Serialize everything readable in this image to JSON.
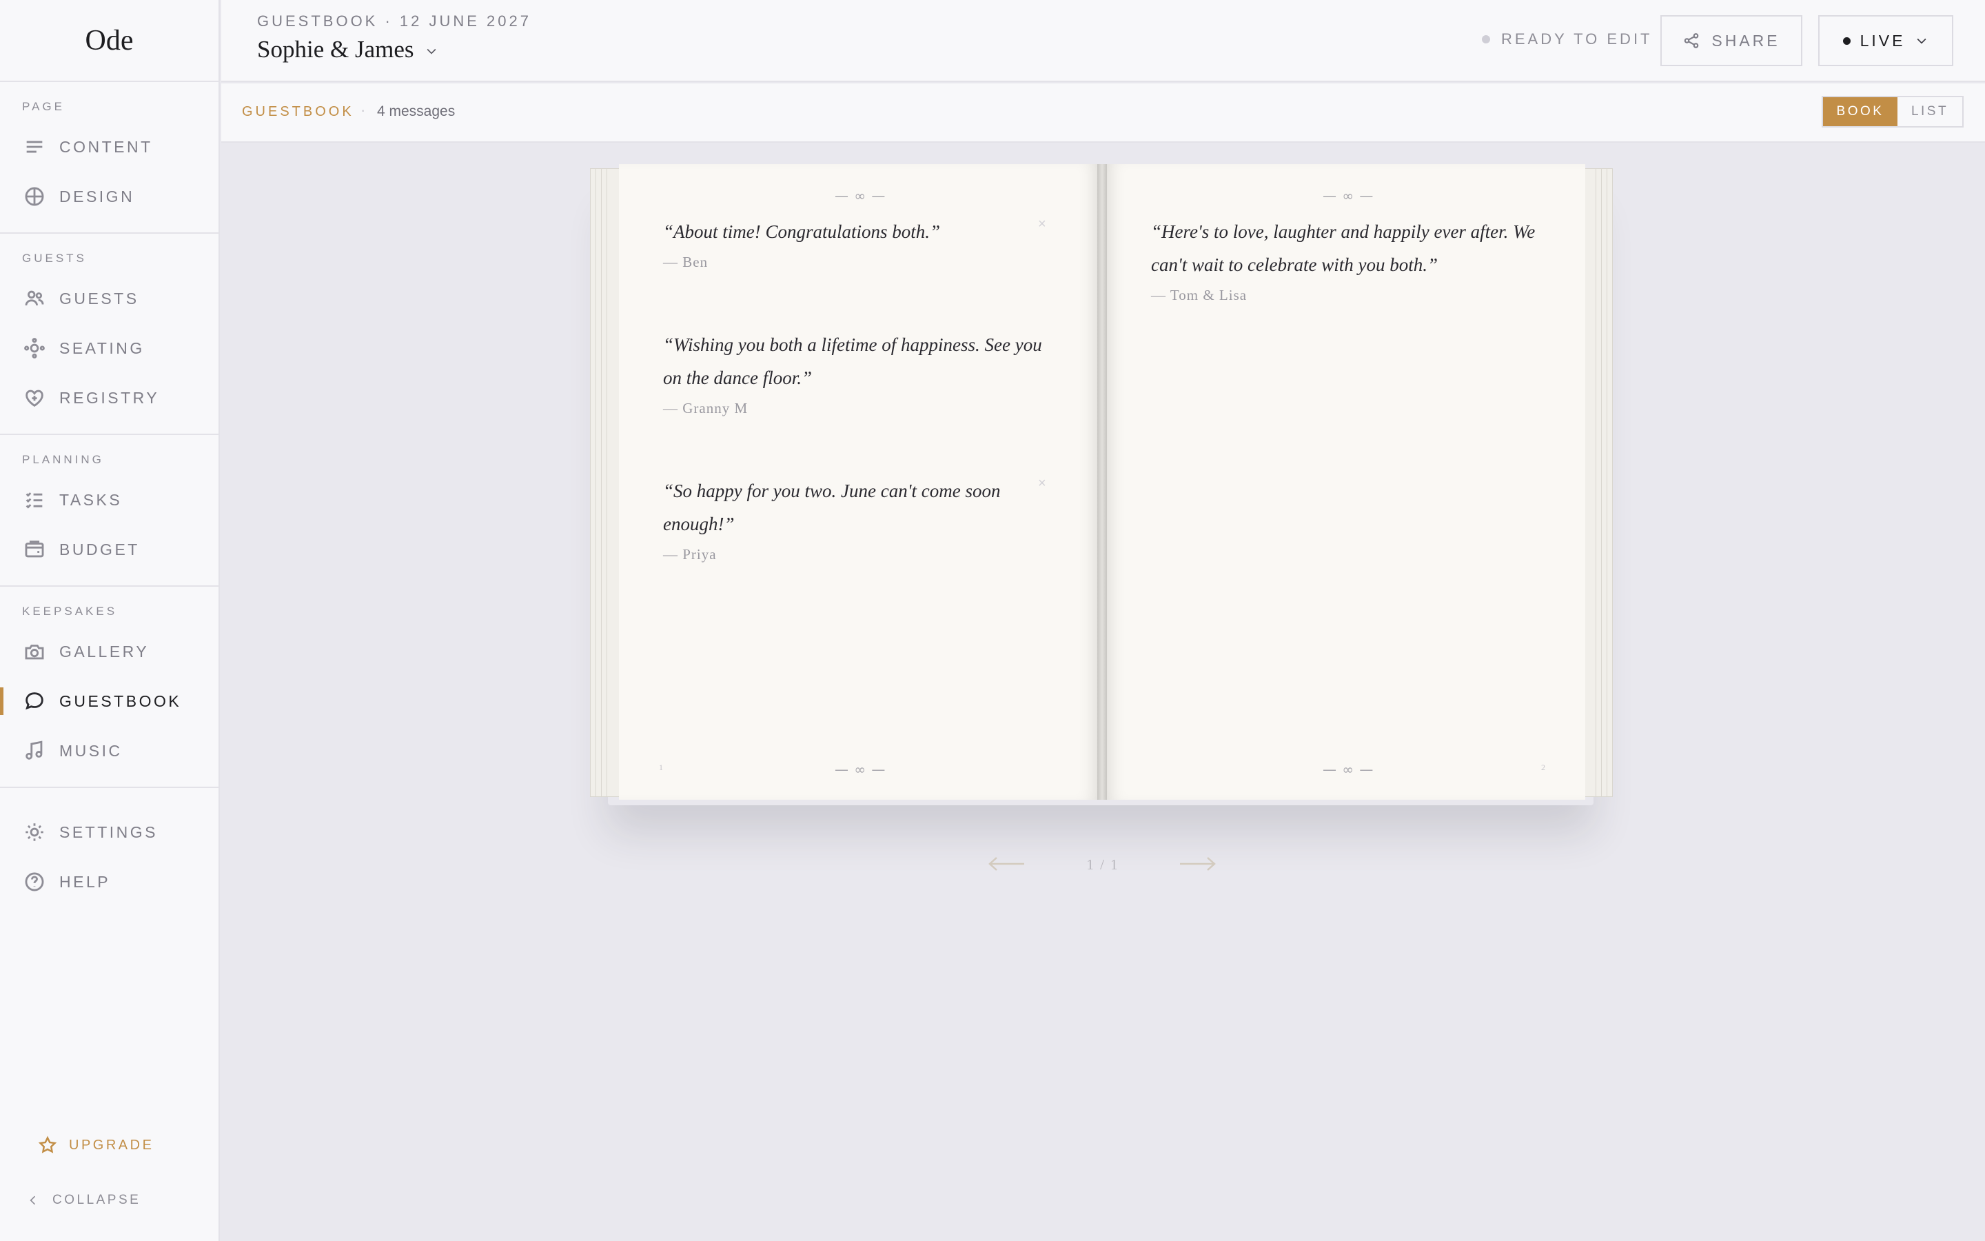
{
  "app": {
    "logo": "Ode"
  },
  "sidebar": {
    "sections": [
      {
        "label": "PAGE",
        "items": [
          {
            "label": "CONTENT",
            "icon": "content-lines-icon"
          },
          {
            "label": "DESIGN",
            "icon": "design-globe-icon"
          }
        ]
      },
      {
        "label": "GUESTS",
        "items": [
          {
            "label": "GUESTS",
            "icon": "users-icon"
          },
          {
            "label": "SEATING",
            "icon": "seating-nodes-icon"
          },
          {
            "label": "REGISTRY",
            "icon": "heart-plus-icon"
          }
        ]
      },
      {
        "label": "PLANNING",
        "items": [
          {
            "label": "TASKS",
            "icon": "checklist-icon"
          },
          {
            "label": "BUDGET",
            "icon": "wallet-icon"
          }
        ]
      },
      {
        "label": "KEEPSAKES",
        "items": [
          {
            "label": "GALLERY",
            "icon": "camera-icon"
          },
          {
            "label": "GUESTBOOK",
            "icon": "speech-bubble-icon",
            "active": true
          },
          {
            "label": "MUSIC",
            "icon": "music-note-icon"
          }
        ]
      },
      {
        "label": "",
        "items": [
          {
            "label": "SETTINGS",
            "icon": "sun-gear-icon"
          },
          {
            "label": "HELP",
            "icon": "help-circle-icon"
          }
        ]
      }
    ],
    "upgrade": "UPGRADE",
    "collapse": "COLLAPSE"
  },
  "header": {
    "breadcrumb": "GUESTBOOK · 12 JUNE 2027",
    "couple": "Sophie & James",
    "status": "READY TO EDIT",
    "share": "SHARE",
    "live": "LIVE"
  },
  "toolbar": {
    "label": "GUESTBOOK",
    "separator": "·",
    "count": "4 messages",
    "view_book": "BOOK",
    "view_list": "LIST",
    "active_view": "BOOK"
  },
  "book": {
    "ornament": "— ∞ —",
    "left_page": {
      "number": "1",
      "messages": [
        {
          "quote": "“About time! Congratulations both.”",
          "author": "— Ben"
        },
        {
          "quote": "“Wishing you both a lifetime of happiness. See you on the dance floor.”",
          "author": "— Granny M"
        },
        {
          "quote": "“So happy for you two. June can't come soon enough!”",
          "author": "— Priya"
        }
      ]
    },
    "right_page": {
      "number": "2",
      "messages": [
        {
          "quote": "“Here's to love, laughter and happily ever after. We can't wait to celebrate with you both.”",
          "author": "— Tom & Lisa"
        }
      ]
    },
    "delete_glyph": "×"
  },
  "pager": {
    "text": "1 / 1"
  },
  "colors": {
    "accent": "#c28e46",
    "page": "#faf8f4",
    "canvas": "#e9e8ee"
  }
}
